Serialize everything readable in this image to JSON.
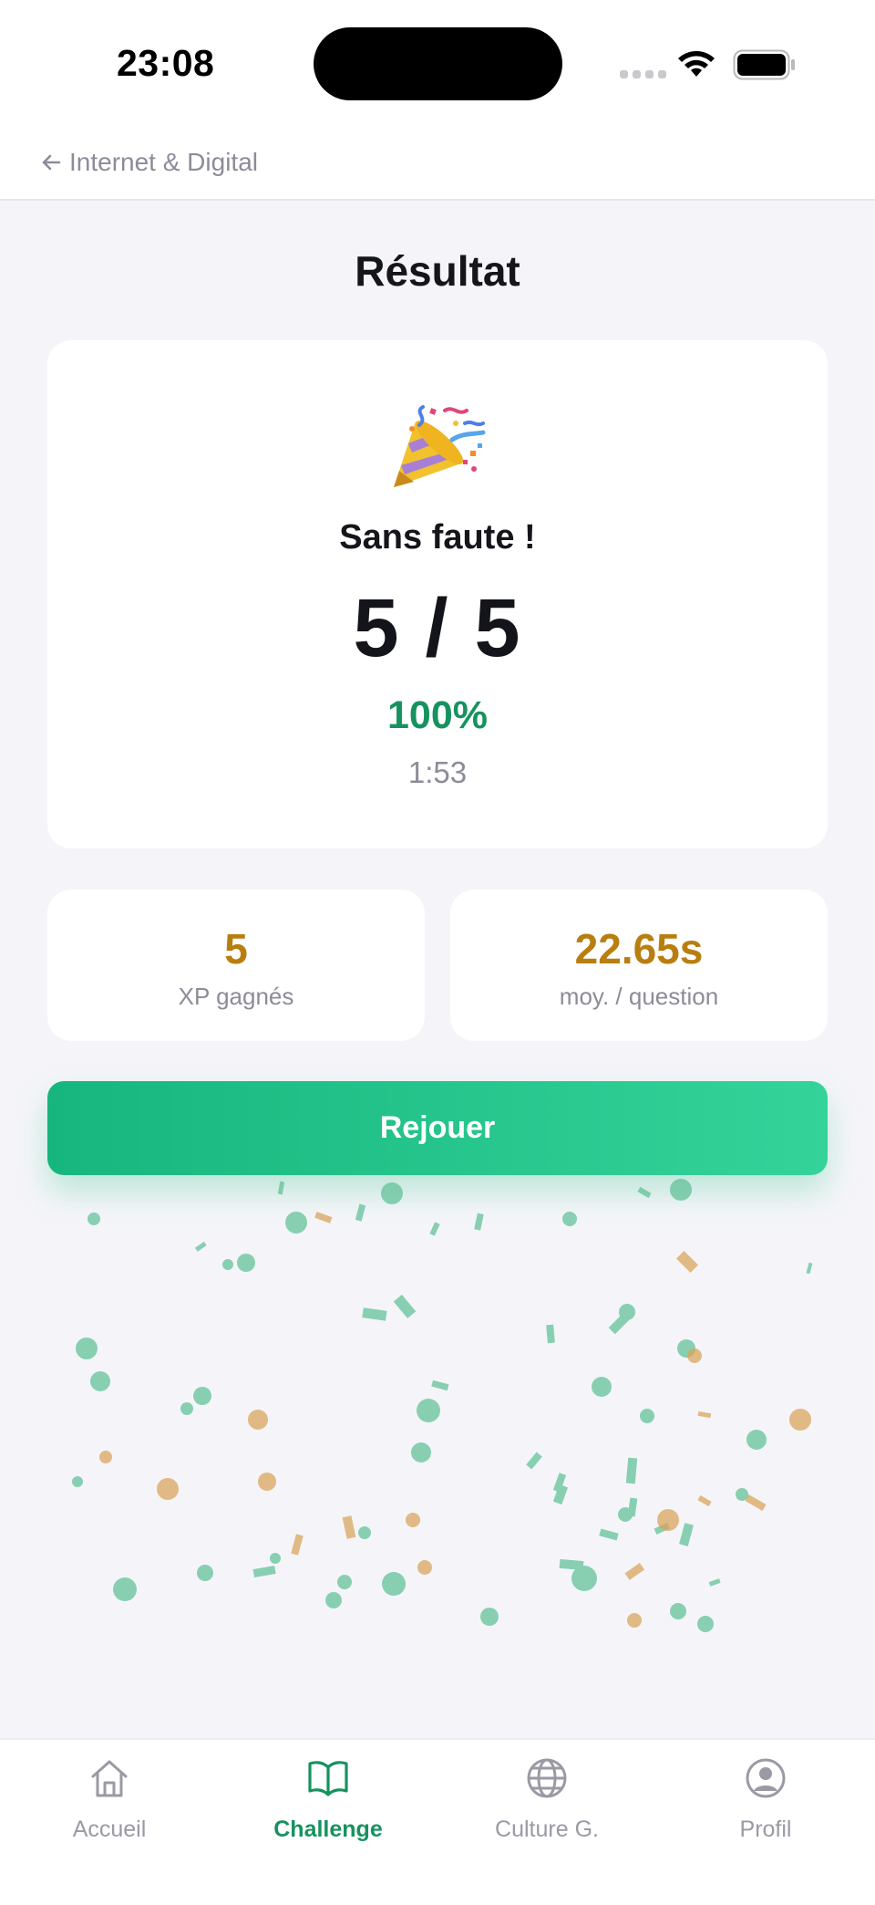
{
  "status_bar": {
    "time": "23:08"
  },
  "header": {
    "back_label": "Internet & Digital"
  },
  "page": {
    "title": "Résultat"
  },
  "result": {
    "headline": "Sans faute !",
    "score": "5 / 5",
    "percent": "100%",
    "duration": "1:53"
  },
  "stats": [
    {
      "value": "5",
      "label": "XP gagnés"
    },
    {
      "value": "22.65s",
      "label": "moy. / question"
    }
  ],
  "actions": {
    "replay_label": "Rejouer"
  },
  "tabs": [
    {
      "label": "Accueil",
      "icon": "home-icon",
      "active": false
    },
    {
      "label": "Challenge",
      "icon": "book-icon",
      "active": true
    },
    {
      "label": "Culture G.",
      "icon": "globe-icon",
      "active": false
    },
    {
      "label": "Profil",
      "icon": "profile-icon",
      "active": false
    }
  ],
  "colors": {
    "accent": "#17925f",
    "button_start": "#16b67e",
    "button_end": "#34d39a",
    "stat_value": "#b97e10",
    "confetti_green": "#5bbf95",
    "confetti_gold": "#d9a45c"
  }
}
